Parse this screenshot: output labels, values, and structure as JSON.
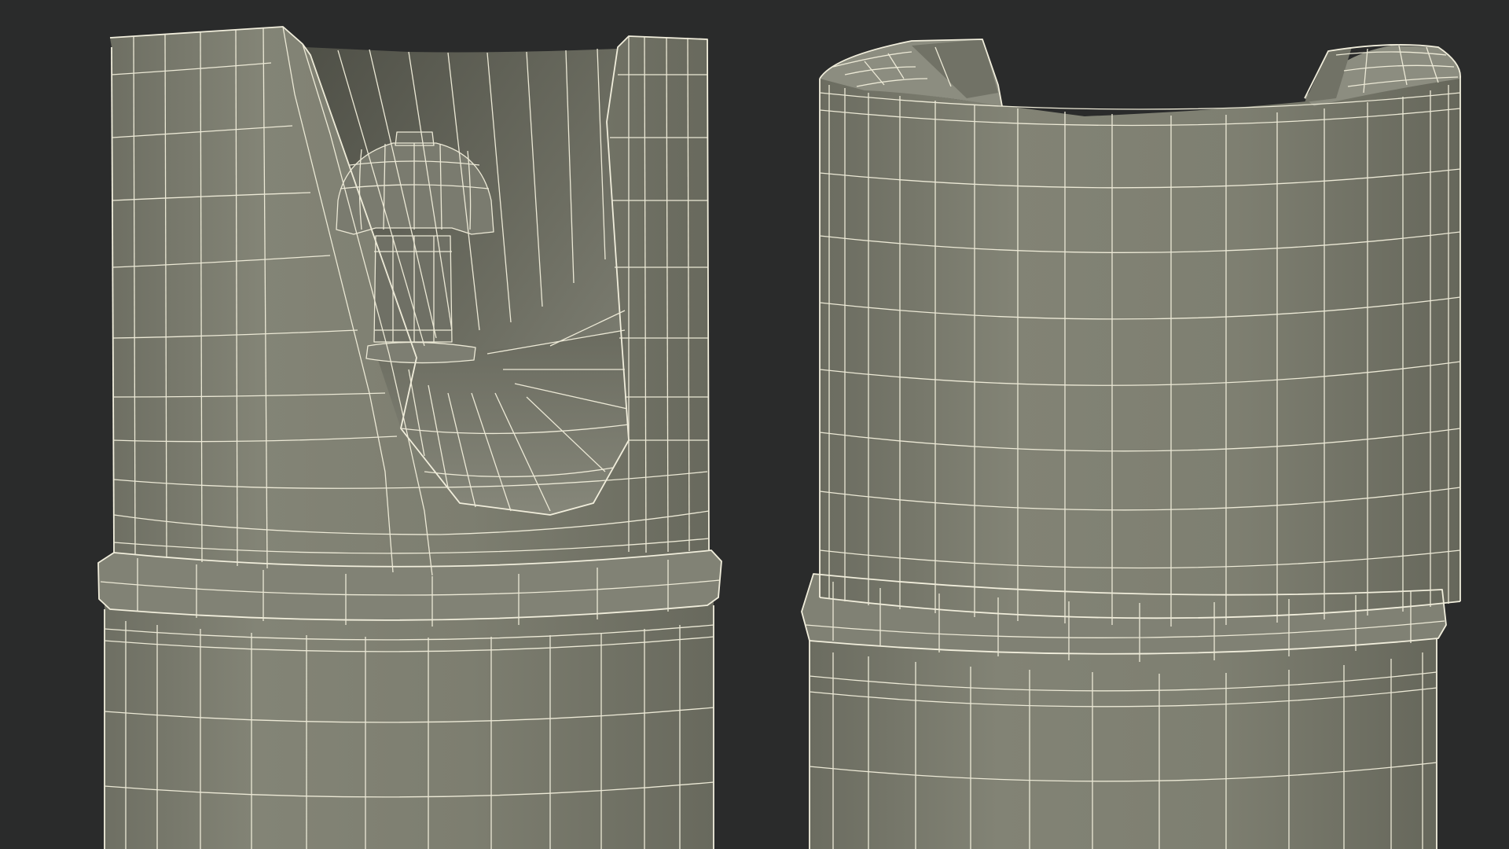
{
  "scene": {
    "objects": [
      {
        "name": "cutaway-cap-model"
      },
      {
        "name": "closed-cap-model"
      }
    ],
    "colors": {
      "background": "#2a2b2b",
      "surface": "#7b7c6e",
      "surface_dark": "#5d5e53",
      "wireframe": "#ece9d6"
    }
  }
}
